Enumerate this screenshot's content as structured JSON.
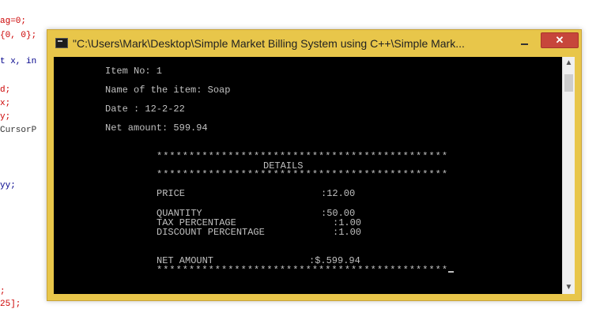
{
  "editor": {
    "lines": [
      {
        "text": "ag=0;",
        "color": "#cc0000"
      },
      {
        "text": "{0, 0};",
        "color": "#cc0000"
      },
      {
        "text": "t x, in",
        "color": "#00008b"
      },
      {
        "text": "d;",
        "color": "#cc0000"
      },
      {
        "text": "x;",
        "color": "#cc0000"
      },
      {
        "text": "y;",
        "color": "#cc0000"
      },
      {
        "text": "CursorP",
        "color": "#333333"
      },
      {
        "text": "yy;",
        "color": "#00008b"
      },
      {
        "text": ";",
        "color": "#cc0000"
      },
      {
        "text": "25];",
        "color": "#cc0000"
      }
    ]
  },
  "window": {
    "title": "\"C:\\Users\\Mark\\Desktop\\Simple Market Billing System using C++\\Simple Mark...",
    "close_label": "✕",
    "accent_color": "#e8c64a"
  },
  "console": {
    "item_no": "Item No: 1",
    "item_name": "Name of the item: Soap",
    "date": "Date : 12-2-22",
    "net_amount": "Net amount: 599.94",
    "stars_top": "*********************************************",
    "details_heading": "DETAILS",
    "stars_mid": "*********************************************",
    "price_label": "PRICE",
    "price_value": ":12.00",
    "quantity_label": "QUANTITY",
    "quantity_value": ":50.00",
    "tax_label": "TAX PERCENTAGE",
    "tax_value": ":1.00",
    "discount_label": "DISCOUNT PERCENTAGE",
    "discount_value": ":1.00",
    "net_label": "NET AMOUNT",
    "net_value": ":$.599.94",
    "stars_bottom": "*********************************************"
  },
  "scrollbar": {
    "up_icon": "▲",
    "down_icon": "▼"
  }
}
